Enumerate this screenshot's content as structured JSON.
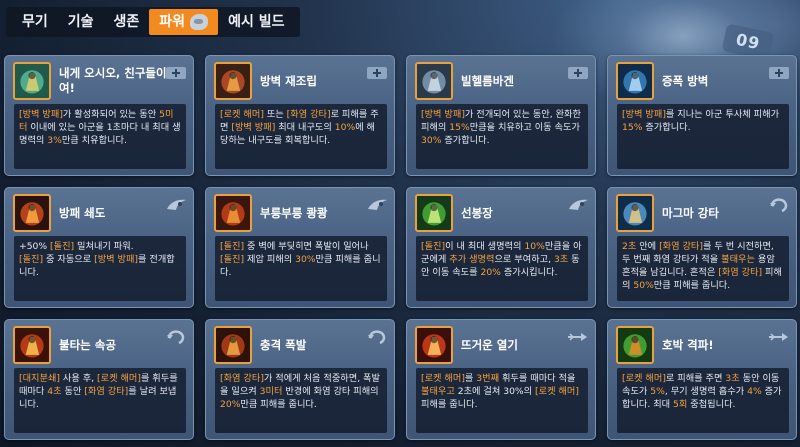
{
  "tabs": [
    {
      "label": "무기",
      "active": false
    },
    {
      "label": "기술",
      "active": false
    },
    {
      "label": "생존",
      "active": false
    },
    {
      "label": "파워",
      "active": true
    },
    {
      "label": "예시 빌드",
      "active": false
    }
  ],
  "background_badge": "09",
  "colors": {
    "accent": "#f38a1f",
    "highlight": "#f4a340",
    "card_bg": "#4a6283",
    "desc_bg": "#121b2c",
    "icon_border": "#e9a23b"
  },
  "cards": [
    {
      "title": "내게 오시오, 친구들이여!",
      "badge": "plus-badge-icon",
      "icon": "crystal-knight-icon",
      "desc": [
        {
          "t": "[방벽 방패]",
          "hl": true
        },
        {
          "t": "가 활성화되어 있는 동안 ",
          "hl": false
        },
        {
          "t": "5미터",
          "hl": true
        },
        {
          "t": " 이내에 있는 아군을 1초마다 내 최대 생명력의 ",
          "hl": false
        },
        {
          "t": "3%",
          "hl": true
        },
        {
          "t": "만큼 치유합니다.",
          "hl": false
        }
      ]
    },
    {
      "title": "방벽 재조립",
      "badge": "plus-badge-icon",
      "icon": "rebuild-shield-icon",
      "desc": [
        {
          "t": "[로켓 해머]",
          "hl": true
        },
        {
          "t": " 또는 ",
          "hl": false
        },
        {
          "t": "[화염 강타]",
          "hl": true
        },
        {
          "t": "로 피해를 주면 ",
          "hl": false
        },
        {
          "t": "[방벽 방패]",
          "hl": true
        },
        {
          "t": " 최대 내구도의 ",
          "hl": false
        },
        {
          "t": "10%",
          "hl": true
        },
        {
          "t": "에 해당하는 내구도를 회복합니다.",
          "hl": false
        }
      ]
    },
    {
      "title": "빌헬름바겐",
      "badge": "plus-badge-icon",
      "icon": "wilhelm-wagon-icon",
      "desc": [
        {
          "t": "[방벽 방패]",
          "hl": true
        },
        {
          "t": "가 전개되어 있는 동안, 완화한 피해의 ",
          "hl": false
        },
        {
          "t": "15%",
          "hl": true
        },
        {
          "t": "만큼을 치유하고 이동 속도가 ",
          "hl": false
        },
        {
          "t": "30%",
          "hl": true
        },
        {
          "t": " 증가합니다.",
          "hl": false
        }
      ]
    },
    {
      "title": "증폭 방벽",
      "badge": "plus-badge-icon",
      "icon": "amplified-barrier-icon",
      "desc": [
        {
          "t": "[방벽 방패]",
          "hl": true
        },
        {
          "t": "를 지나는 아군 투사체 피해가 ",
          "hl": false
        },
        {
          "t": "15%",
          "hl": true
        },
        {
          "t": " 증가합니다.",
          "hl": false
        }
      ]
    },
    {
      "title": "방패 쇄도",
      "badge": "charge-badge-icon",
      "icon": "shield-rush-icon",
      "desc": [
        {
          "t": "+50%",
          "hl": false
        },
        {
          "t": " [돌진]",
          "hl": true
        },
        {
          "t": " 밀쳐내기 파워.",
          "hl": false
        },
        {
          "t": "\n",
          "hl": false
        },
        {
          "t": "[돌진]",
          "hl": true
        },
        {
          "t": " 중 자동으로 ",
          "hl": false
        },
        {
          "t": "[방벽 방패]",
          "hl": true
        },
        {
          "t": "를 전개합니다.",
          "hl": false
        }
      ]
    },
    {
      "title": "부릉부릉 쾅쾅",
      "badge": "charge-badge-icon",
      "icon": "vroom-boom-icon",
      "desc": [
        {
          "t": "[돌진]",
          "hl": true
        },
        {
          "t": " 중 벽에 부딪히면 폭발이 일어나 ",
          "hl": false
        },
        {
          "t": "[돌진]",
          "hl": true
        },
        {
          "t": " 제압 피해의 ",
          "hl": false
        },
        {
          "t": "30%",
          "hl": true
        },
        {
          "t": "만큼 피해를 줍니다.",
          "hl": false
        }
      ]
    },
    {
      "title": "선봉장",
      "badge": "charge-badge-icon",
      "icon": "vanguard-icon",
      "desc": [
        {
          "t": "[돌진]",
          "hl": true
        },
        {
          "t": "이 내 최대 생명력의 ",
          "hl": false
        },
        {
          "t": "10%",
          "hl": true
        },
        {
          "t": "만큼을 아군에게 ",
          "hl": false
        },
        {
          "t": "추가 생명력",
          "hl": true
        },
        {
          "t": "으로 부여하고, ",
          "hl": false
        },
        {
          "t": "3초",
          "hl": true
        },
        {
          "t": " 동안 이동 속도를 ",
          "hl": false
        },
        {
          "t": "20%",
          "hl": true
        },
        {
          "t": " 증가시킵니다.",
          "hl": false
        }
      ]
    },
    {
      "title": "마그마 강타",
      "badge": "swirl-badge-icon",
      "icon": "magma-strike-icon",
      "desc": [
        {
          "t": "2초",
          "hl": true
        },
        {
          "t": " 안에 ",
          "hl": false
        },
        {
          "t": "[화염 강타]",
          "hl": true
        },
        {
          "t": "를 두 번 시전하면, 두 번째 화염 강타가 적을 ",
          "hl": false
        },
        {
          "t": "불태우는",
          "hl": true
        },
        {
          "t": " 용암 흔적을 남깁니다. 흔적은 ",
          "hl": false
        },
        {
          "t": "[화염 강타]",
          "hl": true
        },
        {
          "t": " 피해의 ",
          "hl": false
        },
        {
          "t": "50%",
          "hl": true
        },
        {
          "t": "만큼 피해를 줍니다.",
          "hl": false
        }
      ]
    },
    {
      "title": "불타는 속공",
      "badge": "swirl-badge-icon",
      "icon": "burning-rush-icon",
      "desc": [
        {
          "t": "[대지분쇄]",
          "hl": true
        },
        {
          "t": " 사용 후, ",
          "hl": false
        },
        {
          "t": "[로켓 해머]",
          "hl": true
        },
        {
          "t": "를 휘두를 때마다 ",
          "hl": false
        },
        {
          "t": "4초",
          "hl": true
        },
        {
          "t": " 동안 ",
          "hl": false
        },
        {
          "t": "[화염 강타]",
          "hl": true
        },
        {
          "t": "를 날려 보냅니다.",
          "hl": false
        }
      ]
    },
    {
      "title": "충격 폭발",
      "badge": "swirl-badge-icon",
      "icon": "shock-blast-icon",
      "desc": [
        {
          "t": "[화염 강타]",
          "hl": true
        },
        {
          "t": "가 적에게 처음 적중하면, 폭발을 일으켜 ",
          "hl": false
        },
        {
          "t": "3미터",
          "hl": true
        },
        {
          "t": " 반경에 화염 강타 피해의 ",
          "hl": false
        },
        {
          "t": "20%",
          "hl": true
        },
        {
          "t": "만큼 피해를 줍니다.",
          "hl": false
        }
      ]
    },
    {
      "title": "뜨거운 열기",
      "badge": "arrow-badge-icon",
      "icon": "searing-heat-icon",
      "desc": [
        {
          "t": "[로켓 해머]",
          "hl": true
        },
        {
          "t": "를 ",
          "hl": false
        },
        {
          "t": "3번째",
          "hl": true
        },
        {
          "t": " 휘두를 때마다 적을 ",
          "hl": false
        },
        {
          "t": "불태우고",
          "hl": true
        },
        {
          "t": " 2초에 걸쳐 30%의 ",
          "hl": false
        },
        {
          "t": "[로켓 해머]",
          "hl": true
        },
        {
          "t": " 피해를 줍니다.",
          "hl": false
        }
      ]
    },
    {
      "title": "호박 격파!",
      "badge": "arrow-badge-icon",
      "icon": "pumpkin-smash-icon",
      "desc": [
        {
          "t": "[로켓 해머]",
          "hl": true
        },
        {
          "t": "로 피해를 주면 ",
          "hl": false
        },
        {
          "t": "3초",
          "hl": true
        },
        {
          "t": " 동안 이동 속도가 ",
          "hl": false
        },
        {
          "t": "5%",
          "hl": true
        },
        {
          "t": ", 무기 생명력 흡수가 ",
          "hl": false
        },
        {
          "t": "4%",
          "hl": true
        },
        {
          "t": " 증가합니다. 최대 ",
          "hl": false
        },
        {
          "t": "5회",
          "hl": true
        },
        {
          "t": " 중첩됩니다.",
          "hl": false
        }
      ]
    }
  ]
}
